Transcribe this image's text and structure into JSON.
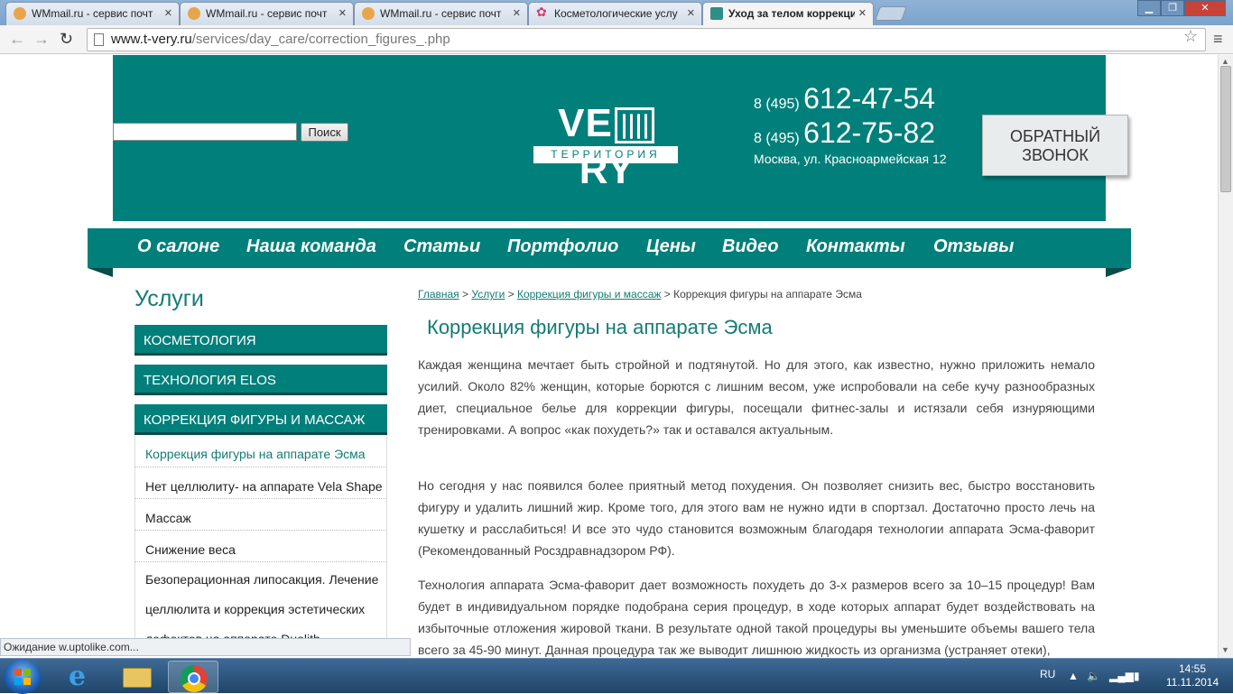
{
  "browser": {
    "tabs": [
      {
        "title": "WMmail.ru - сервис почт",
        "icon": "wmmail-favicon"
      },
      {
        "title": "WMmail.ru - сервис почт",
        "icon": "wmmail-favicon"
      },
      {
        "title": "WMmail.ru - сервис почт",
        "icon": "wmmail-favicon"
      },
      {
        "title": "Косметологические услу",
        "icon": "flower-favicon"
      },
      {
        "title": "Уход за телом коррекция",
        "icon": "tvery-favicon",
        "active": true
      }
    ],
    "url_host": "www.t-very.ru",
    "url_path": "/services/day_care/correction_figures_.php",
    "status_text": "Ожидание w.uptolike.com..."
  },
  "site": {
    "search_button": "Поиск",
    "search_value": "",
    "logo_word_left": "VE",
    "logo_word_right": "RY",
    "logo_sub": "ТЕРРИТОРИЯ",
    "phones": [
      {
        "code": "8 (495)",
        "number": "612-47-54"
      },
      {
        "code": "8 (495)",
        "number": "612-75-82"
      }
    ],
    "address": "Москва, ул. Красноармейская 12",
    "callback_line1": "ОБРАТНЫЙ",
    "callback_line2": "ЗВОНОК",
    "nav": [
      "О салоне",
      "Наша команда",
      "Статьи",
      "Портфолио",
      "Цены",
      "Видео",
      "Контакты",
      "Отзывы"
    ]
  },
  "sidebar": {
    "title": "Услуги",
    "categories": [
      "КОСМЕТОЛОГИЯ",
      "ТЕХНОЛОГИЯ ELOS",
      "КОРРЕКЦИЯ ФИГУРЫ И МАССАЖ"
    ],
    "subitems": [
      "Коррекция фигуры на аппарате Эсма",
      "Нет целлюлиту- на аппарате Vela Shape",
      "Массаж",
      "Снижение веса",
      "Безоперационная липосакция. Лечение целлюлита и коррекция эстетических дефектов на аппарате Duolith"
    ]
  },
  "main": {
    "breadcrumb": [
      "Главная",
      "Услуги",
      "Коррекция фигуры и массаж",
      "Коррекция фигуры на аппарате Эсма"
    ],
    "breadcrumb_sep": " > ",
    "title": "Коррекция фигуры на аппарате Эсма",
    "paragraphs": [
      "Каждая женщина мечтает быть стройной и подтянутой. Но для этого, как известно, нужно приложить немало усилий. Около 82% женщин, которые борются с лишним весом, уже испробовали на себе кучу разнообразных диет, специальное белье для коррекции фигуры, посещали фитнес-залы и истязали себя изнуряющими тренировками. А вопрос «как похудеть?» так и оставался актуальным.",
      "Но сегодня у нас появился более приятный метод похудения. Он позволяет снизить вес, быстро восстановить фигуру и удалить лишний жир. Кроме того, для этого вам не нужно идти в спортзал. Достаточно просто лечь на кушетку и расслабиться! И все это чудо становится возможным благодаря технологии аппарата Эсма-фаворит (Рекомендованный Росздравнадзором РФ).",
      "Технология аппарата Эсма-фаворит дает возможность похудеть до 3-х размеров всего за 10–15 процедур! Вам будет в индивидуальном порядке подобрана серия процедур, в ходе которых аппарат будет воздействовать на избыточные отложения жировой ткани. В результате одной такой процедуры вы уменьшите объемы вашего тела всего за 45-90 минут. Данная процедура так же выводит лишнюю жидкость из организма (устраняет отеки),"
    ]
  },
  "taskbar": {
    "apps": [
      "internet-explorer",
      "windows-explorer",
      "google-chrome"
    ],
    "lang": "RU",
    "time": "14:55",
    "date": "11.11.2014"
  },
  "colors": {
    "brand_teal": "#017f7a",
    "link_teal": "#147b74"
  }
}
